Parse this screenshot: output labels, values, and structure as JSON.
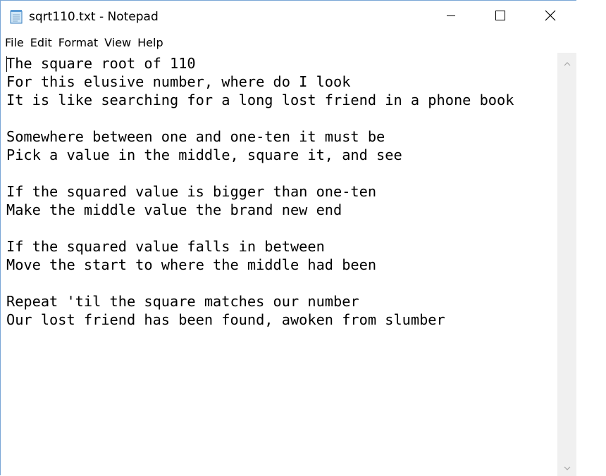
{
  "window": {
    "title": "sqrt110.txt - Notepad",
    "app_icon": "notepad-icon",
    "controls": {
      "minimize_icon": "minimize-icon",
      "maximize_icon": "maximize-icon",
      "close_icon": "close-icon"
    }
  },
  "menu": {
    "items": [
      "File",
      "Edit",
      "Format",
      "View",
      "Help"
    ]
  },
  "editor": {
    "content": "The square root of 110\nFor this elusive number, where do I look\nIt is like searching for a long lost friend in a phone book\n\nSomewhere between one and one-ten it must be\nPick a value in the middle, square it, and see\n\nIf the squared value is bigger than one-ten\nMake the middle value the brand new end\n\nIf the squared value falls in between\nMove the start to where the middle had been\n\nRepeat 'til the square matches our number\nOur lost friend has been found, awoken from slumber"
  },
  "scrollbar": {
    "up_icon": "chevron-up-icon",
    "down_icon": "chevron-down-icon"
  },
  "colors": {
    "window_border": "#7aa6d6",
    "scrollbar_track": "#f0f0f0",
    "text": "#000000"
  }
}
